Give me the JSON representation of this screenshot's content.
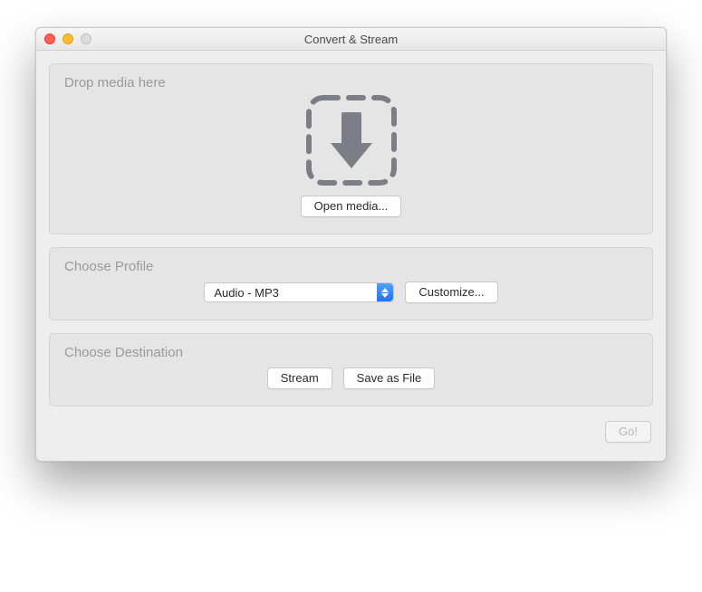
{
  "window": {
    "title": "Convert & Stream"
  },
  "drop": {
    "heading": "Drop media here",
    "open_label": "Open media..."
  },
  "profile": {
    "heading": "Choose Profile",
    "selected": "Audio - MP3",
    "customize_label": "Customize..."
  },
  "destination": {
    "heading": "Choose Destination",
    "stream_label": "Stream",
    "save_label": "Save as File"
  },
  "footer": {
    "go_label": "Go!"
  }
}
